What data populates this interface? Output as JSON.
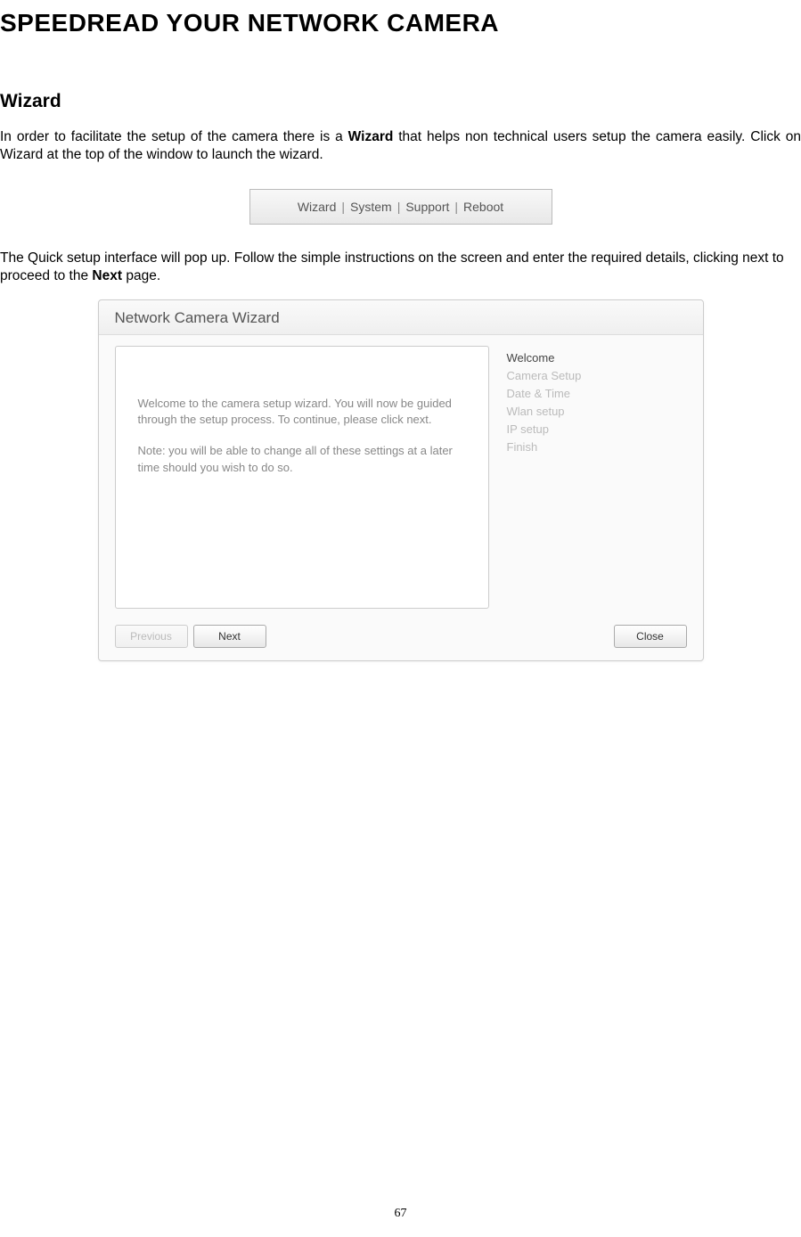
{
  "page_title": "SPEEDREAD YOUR NETWORK CAMERA",
  "section_heading": "Wizard",
  "paragraph1_a": "In order to facilitate the setup of the camera there is a ",
  "paragraph1_bold": "Wizard",
  "paragraph1_b": " that helps non technical users setup the camera easily. Click on Wizard at the top of the window to launch the wizard.",
  "toolbar": {
    "items": [
      "Wizard",
      "System",
      "Support",
      "Reboot"
    ]
  },
  "paragraph2_a": "The Quick setup interface will pop up. Follow the simple instructions on the screen and enter the required details, clicking next to proceed to the ",
  "paragraph2_bold": "Next",
  "paragraph2_b": " page.",
  "wizard": {
    "title": "Network Camera Wizard",
    "body_p1": "Welcome to the camera setup wizard. You will now be guided through the setup process. To continue, please click next.",
    "body_p2": "Note: you will be able to change all of these settings at a later time should you wish to do so.",
    "steps": [
      {
        "label": "Welcome",
        "active": true
      },
      {
        "label": "Camera Setup",
        "active": false
      },
      {
        "label": "Date & Time",
        "active": false
      },
      {
        "label": "Wlan setup",
        "active": false
      },
      {
        "label": "IP setup",
        "active": false
      },
      {
        "label": "Finish",
        "active": false
      }
    ],
    "buttons": {
      "previous": "Previous",
      "next": "Next",
      "close": "Close"
    }
  },
  "page_number": "67"
}
